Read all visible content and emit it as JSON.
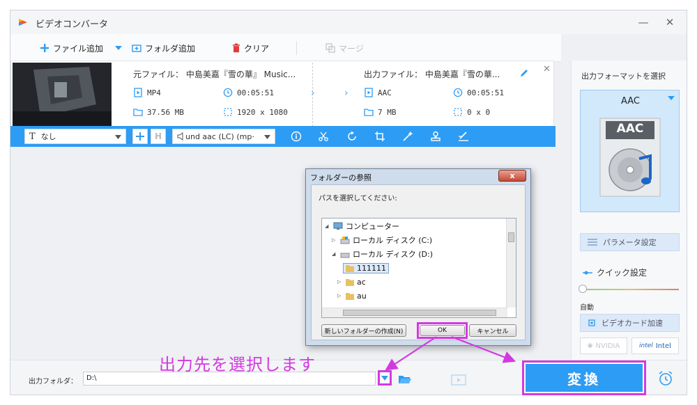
{
  "app": {
    "title": "ビデオコンバータ"
  },
  "toolbar": {
    "add_file": "ファイル追加",
    "add_folder": "フォルダ追加",
    "clear": "クリア",
    "merge": "マージ"
  },
  "file": {
    "source_name": "元ファイル： 中島美嘉『雪の華』 Music...",
    "source_format": "MP4",
    "source_duration": "00:05:51",
    "source_size": "37.56 MB",
    "source_resolution": "1920 x 1080",
    "output_name": "出力ファイル： 中島美嘉『雪の華...",
    "output_format": "AAC",
    "output_duration": "00:05:51",
    "output_size": "7 MB",
    "output_resolution": "0 x 0"
  },
  "editbar": {
    "subtitle": "なし",
    "audio_track": "und aac (LC) (mp·"
  },
  "right_panel": {
    "title": "出力フォーマットを選択",
    "format": "AAC",
    "format_logo_text": "AAC",
    "param_button": "パラメータ設定",
    "quick_label": "クイック設定",
    "slider_label": "自動",
    "gpu_button": "ビデオカード加速",
    "nvidia": "NVIDIA",
    "intel": "Intel"
  },
  "bottom": {
    "output_folder_label": "出力フォルダ：",
    "output_folder_value": "D:\\",
    "convert_label": "変換"
  },
  "annotation": {
    "text": "出力先を選択します"
  },
  "dialog": {
    "title": "フォルダーの参照",
    "close": "x",
    "prompt": "パスを選択してください:",
    "tree": [
      {
        "label": "コンピューター"
      },
      {
        "label": "ローカル ディスク (C:)"
      },
      {
        "label": "ローカル ディスク (D:)"
      },
      {
        "label": "111111"
      },
      {
        "label": "ac"
      },
      {
        "label": "au"
      }
    ],
    "new_folder_button": "新しいフォルダーの作成(N)",
    "ok_button": "OK",
    "cancel_button": "キャンセル"
  },
  "colors": {
    "accent": "#2d9cf4",
    "highlight": "#d23ae0"
  }
}
